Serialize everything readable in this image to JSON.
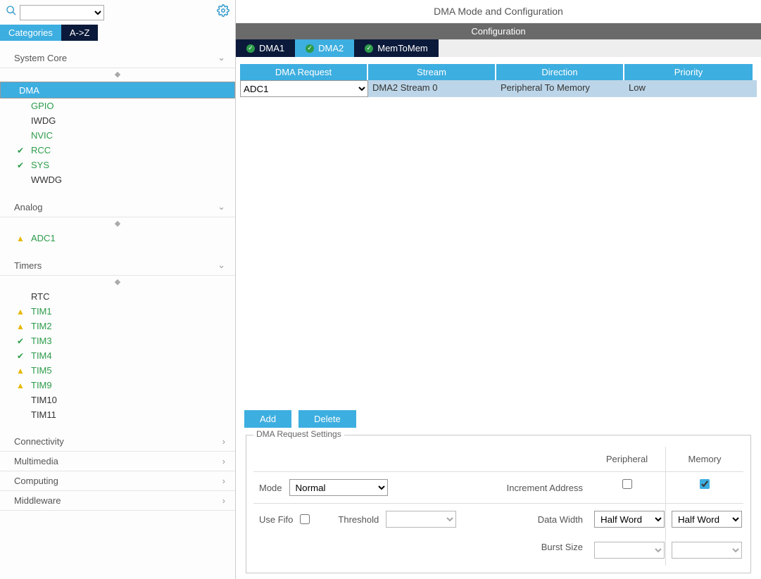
{
  "sidebar": {
    "search_placeholder": "",
    "tabs": {
      "categories": "Categories",
      "az": "A->Z"
    },
    "sections": [
      {
        "title": "System Core",
        "items": [
          {
            "label": "DMA",
            "style": "sel",
            "icon": ""
          },
          {
            "label": "GPIO",
            "style": "green",
            "icon": ""
          },
          {
            "label": "IWDG",
            "style": "plain",
            "icon": ""
          },
          {
            "label": "NVIC",
            "style": "green",
            "icon": ""
          },
          {
            "label": "RCC",
            "style": "green",
            "icon": "check"
          },
          {
            "label": "SYS",
            "style": "green",
            "icon": "check"
          },
          {
            "label": "WWDG",
            "style": "plain",
            "icon": ""
          }
        ]
      },
      {
        "title": "Analog",
        "items": [
          {
            "label": "ADC1",
            "style": "green",
            "icon": "warn"
          }
        ]
      },
      {
        "title": "Timers",
        "items": [
          {
            "label": "RTC",
            "style": "plain",
            "icon": ""
          },
          {
            "label": "TIM1",
            "style": "green",
            "icon": "warn"
          },
          {
            "label": "TIM2",
            "style": "green",
            "icon": "warn"
          },
          {
            "label": "TIM3",
            "style": "green",
            "icon": "check"
          },
          {
            "label": "TIM4",
            "style": "green",
            "icon": "check"
          },
          {
            "label": "TIM5",
            "style": "green",
            "icon": "warn"
          },
          {
            "label": "TIM9",
            "style": "green",
            "icon": "warn"
          },
          {
            "label": "TIM10",
            "style": "plain",
            "icon": ""
          },
          {
            "label": "TIM11",
            "style": "plain",
            "icon": ""
          }
        ]
      }
    ],
    "collapsed": [
      {
        "title": "Connectivity"
      },
      {
        "title": "Multimedia"
      },
      {
        "title": "Computing"
      },
      {
        "title": "Middleware"
      }
    ]
  },
  "main": {
    "title": "DMA Mode and Configuration",
    "config_label": "Configuration",
    "dma_tabs": [
      "DMA1",
      "DMA2",
      "MemToMem"
    ],
    "table": {
      "headers": [
        "DMA Request",
        "Stream",
        "Direction",
        "Priority"
      ],
      "row": {
        "request": "ADC1",
        "stream": "DMA2 Stream 0",
        "direction": "Peripheral To Memory",
        "priority": "Low"
      }
    },
    "buttons": {
      "add": "Add",
      "delete": "Delete"
    },
    "settings": {
      "legend": "DMA Request Settings",
      "col_periph": "Peripheral",
      "col_memory": "Memory",
      "mode_label": "Mode",
      "mode_value": "Normal",
      "inc_label": "Increment Address",
      "periph_inc": false,
      "mem_inc": true,
      "fifo_label": "Use Fifo",
      "fifo_checked": false,
      "threshold_label": "Threshold",
      "threshold_value": "",
      "datawidth_label": "Data Width",
      "dw_periph": "Half Word",
      "dw_mem": "Half Word",
      "burst_label": "Burst Size",
      "burst_periph": "",
      "burst_mem": ""
    }
  }
}
